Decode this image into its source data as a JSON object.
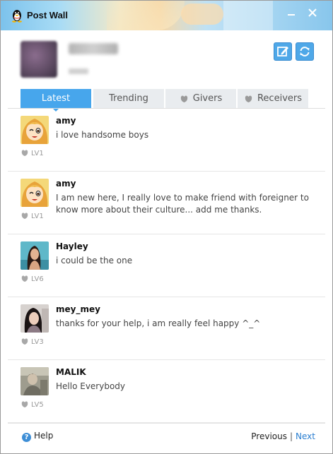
{
  "window": {
    "title": "Post Wall"
  },
  "profile": {
    "name": "",
    "sub": ""
  },
  "tabs": [
    {
      "label": "Latest",
      "active": true
    },
    {
      "label": "Trending",
      "active": false
    },
    {
      "label": "Givers",
      "active": false
    },
    {
      "label": "Receivers",
      "active": false
    }
  ],
  "posts": [
    {
      "username": "amy",
      "message": "i love handsome boys",
      "level": "LV1",
      "avatar": "cartoon-girl"
    },
    {
      "username": "amy",
      "message": "I am new here, I really love to make friend with foreigner to know more about their culture... add me thanks.",
      "level": "LV1",
      "avatar": "cartoon-girl"
    },
    {
      "username": "Hayley",
      "message": "i could be the one",
      "level": "LV6",
      "avatar": "photo"
    },
    {
      "username": "mey_mey",
      "message": "thanks for your help, i am really feel happy ^_^",
      "level": "LV3",
      "avatar": "photo"
    },
    {
      "username": "MALIK",
      "message": "Hello Everybody",
      "level": "LV5",
      "avatar": "photo"
    }
  ],
  "footer": {
    "help": "Help",
    "previous": "Previous",
    "separator": "|",
    "next": "Next"
  },
  "colors": {
    "accent": "#47a6ec",
    "link": "#2a7ed0",
    "tab_inactive": "#e9ecef"
  }
}
